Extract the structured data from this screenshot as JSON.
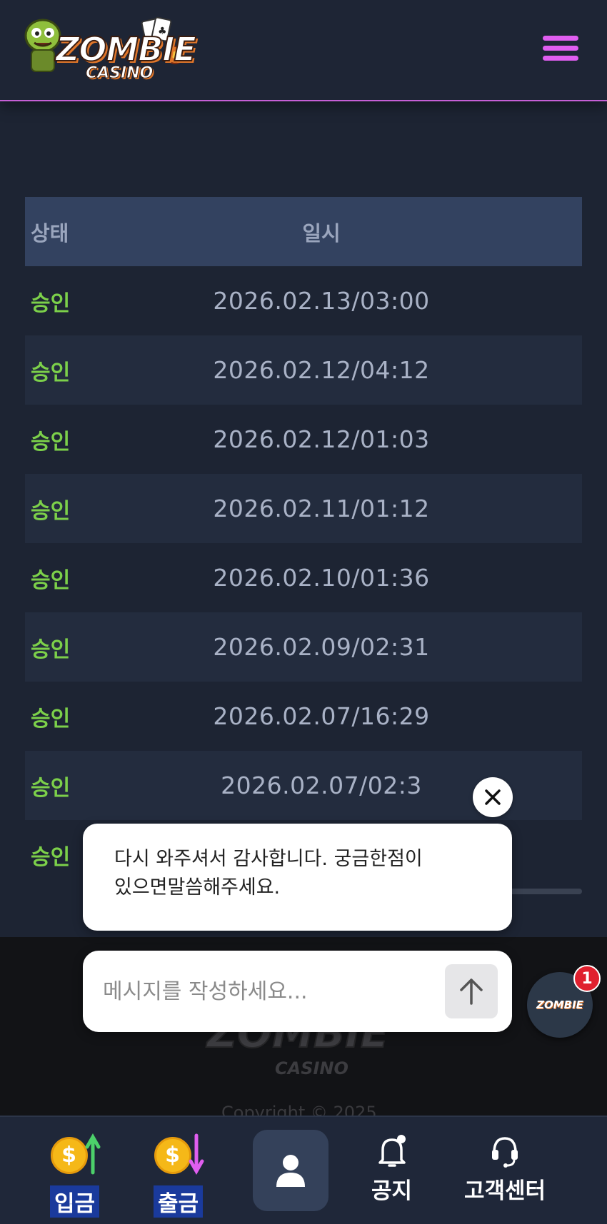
{
  "header": {
    "logo_main": "ZOMBIE",
    "logo_sub": "CASINO"
  },
  "table": {
    "headers": {
      "status": "상태",
      "datetime": "일시"
    },
    "rows": [
      {
        "status": "승인",
        "datetime": "2026.02.13/03:00"
      },
      {
        "status": "승인",
        "datetime": "2026.02.12/04:12"
      },
      {
        "status": "승인",
        "datetime": "2026.02.12/01:03"
      },
      {
        "status": "승인",
        "datetime": "2026.02.11/01:12"
      },
      {
        "status": "승인",
        "datetime": "2026.02.10/01:36"
      },
      {
        "status": "승인",
        "datetime": "2026.02.09/02:31"
      },
      {
        "status": "승인",
        "datetime": "2026.02.07/16:29"
      },
      {
        "status": "승인",
        "datetime": "2026.02.07/02:3"
      },
      {
        "status": "승인",
        "datetime": ""
      }
    ]
  },
  "footer": {
    "logo_main": "ZOMBIE",
    "logo_sub": "CASINO",
    "copyright": "Copyright © 2025"
  },
  "chat": {
    "message_line1": "다시 와주셔서 감사합니다. 궁금한점이",
    "message_line2": "있으면말씀해주세요.",
    "input_placeholder": "메시지를 작성하세요...",
    "launcher_logo": "ZOMBIE",
    "unread_count": "1"
  },
  "bottom_nav": {
    "deposit": "입금",
    "withdraw": "출금",
    "notice": "공지",
    "support": "고객센터"
  },
  "colors": {
    "accent": "#e05ef0",
    "status_approved": "#7cd04a",
    "header_row": "#334260"
  }
}
